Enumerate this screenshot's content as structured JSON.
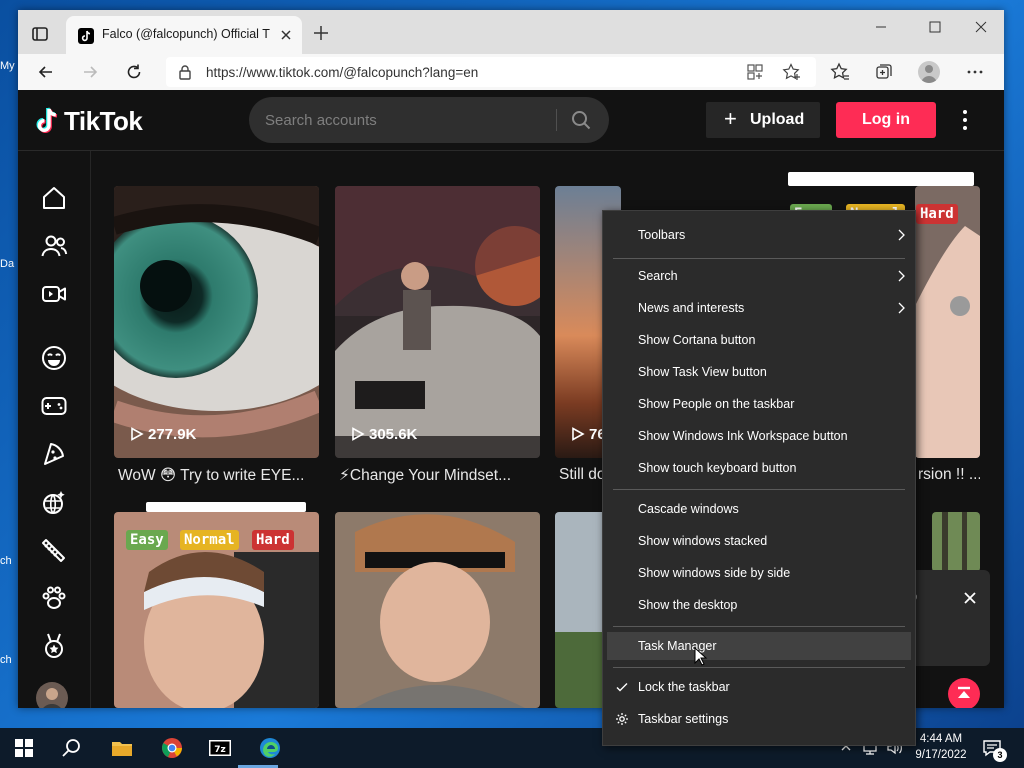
{
  "desktop": {
    "fragments": [
      "My",
      "Da",
      "ch",
      "ch"
    ]
  },
  "browser": {
    "tab_title": "Falco (@falcopunch) Official TikTok",
    "url": "https://www.tiktok.com/@falcopunch?lang=en"
  },
  "tiktok": {
    "logo_text": "TikTok",
    "search_placeholder": "Search accounts",
    "upload_label": "Upload",
    "login_label": "Log in",
    "brand_color": "#fe2c55",
    "videos": [
      {
        "views": "277.9K",
        "caption": "WoW 😳 Try to write EYE..."
      },
      {
        "views": "305.6K",
        "caption": "⚡Change Your Mindset..."
      },
      {
        "views": "76",
        "caption": "Still do"
      },
      {
        "views": "",
        "caption": "rsion !! ..."
      }
    ],
    "tags_row1": [
      "Easy",
      "Normal",
      "Hard"
    ],
    "tags_row2": [
      "Easy",
      "Normal",
      "Hard"
    ],
    "popup_fragment": "p"
  },
  "context_menu": {
    "items": [
      {
        "label": "Toolbars",
        "submenu": true
      },
      {
        "label": "Search",
        "submenu": true
      },
      {
        "label": "News and interests",
        "submenu": true
      },
      {
        "label": "Show Cortana button"
      },
      {
        "label": "Show Task View button"
      },
      {
        "label": "Show People on the taskbar"
      },
      {
        "label": "Show Windows Ink Workspace button"
      },
      {
        "label": "Show touch keyboard button"
      },
      {
        "label": "Cascade windows"
      },
      {
        "label": "Show windows stacked"
      },
      {
        "label": "Show windows side by side"
      },
      {
        "label": "Show the desktop"
      },
      {
        "label": "Task Manager",
        "highlighted": true
      },
      {
        "label": "Lock the taskbar",
        "checked": true
      },
      {
        "label": "Taskbar settings",
        "icon": "gear-icon"
      }
    ]
  },
  "taskbar": {
    "time": "4:44 AM",
    "date": "9/17/2022",
    "notification_count": "3",
    "apps": [
      "start-icon",
      "search-icon",
      "file-explorer-icon",
      "chrome-icon",
      "7zip-icon",
      "edge-icon"
    ]
  }
}
